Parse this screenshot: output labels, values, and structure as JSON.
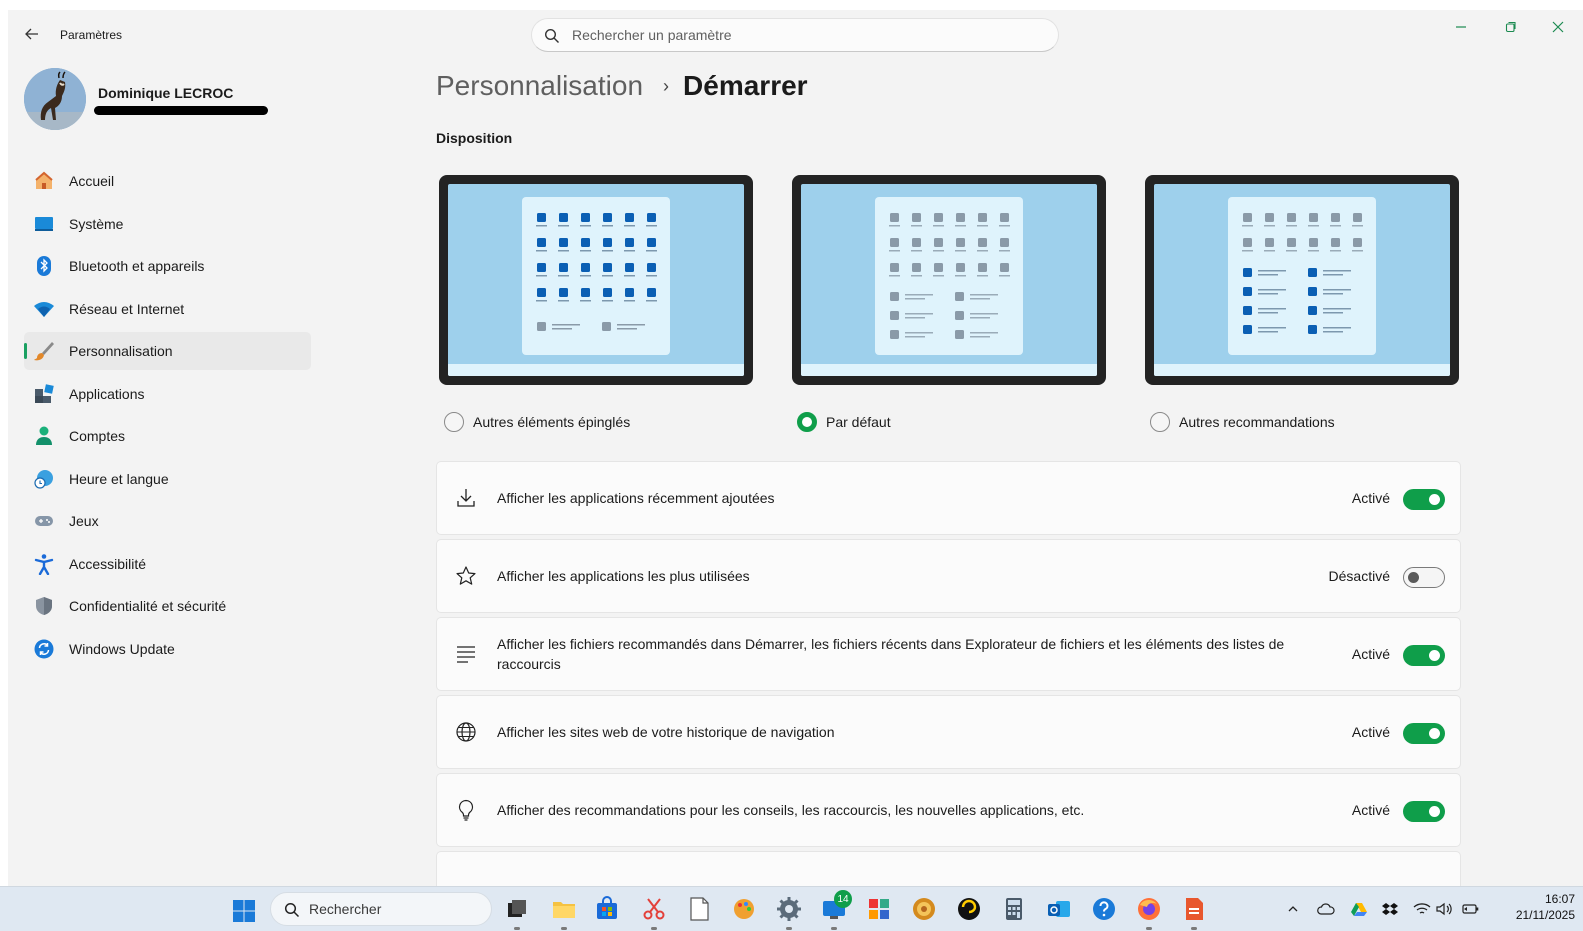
{
  "window": {
    "title": "Paramètres",
    "search_placeholder": "Rechercher un paramètre"
  },
  "user": {
    "name": "Dominique LECROC"
  },
  "sidebar": {
    "items": [
      {
        "label": "Accueil",
        "icon": "home-icon"
      },
      {
        "label": "Système",
        "icon": "system-icon"
      },
      {
        "label": "Bluetooth et appareils",
        "icon": "bluetooth-icon"
      },
      {
        "label": "Réseau et Internet",
        "icon": "wifi-icon"
      },
      {
        "label": "Personnalisation",
        "icon": "brush-icon",
        "active": true
      },
      {
        "label": "Applications",
        "icon": "apps-icon"
      },
      {
        "label": "Comptes",
        "icon": "accounts-icon"
      },
      {
        "label": "Heure et langue",
        "icon": "time-language-icon"
      },
      {
        "label": "Jeux",
        "icon": "gamepad-icon"
      },
      {
        "label": "Accessibilité",
        "icon": "accessibility-icon"
      },
      {
        "label": "Confidentialité et sécurité",
        "icon": "shield-icon"
      },
      {
        "label": "Windows Update",
        "icon": "update-icon"
      }
    ]
  },
  "main": {
    "breadcrumb_parent": "Personnalisation",
    "breadcrumb_separator": "›",
    "breadcrumb_current": "Démarrer",
    "section_title": "Disposition",
    "layouts": [
      {
        "label": "Autres éléments épinglés",
        "checked": false
      },
      {
        "label": "Par défaut",
        "checked": true
      },
      {
        "label": "Autres recommandations",
        "checked": false
      }
    ],
    "settings": [
      {
        "icon": "download-icon",
        "label": "Afficher les applications récemment ajoutées",
        "state": "Activé",
        "on": true
      },
      {
        "icon": "star-icon",
        "label": "Afficher les applications les plus utilisées",
        "state": "Désactivé",
        "on": false
      },
      {
        "icon": "list-icon",
        "label": "Afficher les fichiers recommandés dans Démarrer, les fichiers récents dans Explorateur de fichiers et les éléments des listes de raccourcis",
        "state": "Activé",
        "on": true
      },
      {
        "icon": "globe-icon",
        "label": "Afficher les sites web de votre historique de navigation",
        "state": "Activé",
        "on": true
      },
      {
        "icon": "lightbulb-icon",
        "label": "Afficher des recommandations pour les conseils, les raccourcis, les nouvelles applications, etc.",
        "state": "Activé",
        "on": true
      }
    ]
  },
  "taskbar": {
    "search_label": "Rechercher",
    "notification_badge": "14",
    "time": "16:07",
    "date": "21/11/2025",
    "accent": "#0f9e4a"
  }
}
